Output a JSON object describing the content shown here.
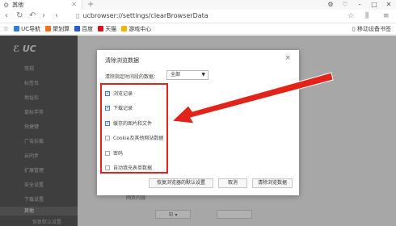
{
  "browser": {
    "tab_title": "其他",
    "tab_icon": "gear-icon",
    "address": "ucbrowser://settings/clearBrowserData",
    "window_controls": [
      "-",
      "□",
      "✕"
    ]
  },
  "bookmarks": {
    "items": [
      {
        "label": "UC导航",
        "color": "#2f7de1"
      },
      {
        "label": "聚划算",
        "color": "#f2711c"
      },
      {
        "label": "百度",
        "color": "#2a5bd7"
      },
      {
        "label": "天猫",
        "color": "#d7141b"
      },
      {
        "label": "游戏中心",
        "color": "#f5b400"
      }
    ],
    "mobile_label": "移动设备书签"
  },
  "settings": {
    "logo": "UC",
    "sidebar": [
      "常规",
      "标签页",
      "地址栏",
      "鼠标手势",
      "快捷键",
      "广告拦截",
      "云同步",
      "扩展管理",
      "安全设置",
      "下载设置",
      "其他"
    ],
    "sidebar_sub": "恢复默认设置",
    "background_label": "网页内容"
  },
  "dialog": {
    "title": "清除浏览数据",
    "close": "×",
    "range_label": "清除指定时间段的数据：",
    "range_value": "全部",
    "options": [
      {
        "label": "浏览记录",
        "checked": true
      },
      {
        "label": "下载记录",
        "checked": true
      },
      {
        "label": "缓存的图片和文件",
        "checked": true
      },
      {
        "label": "Cookie及其他网站数据",
        "checked": false
      },
      {
        "label": "密码",
        "checked": false
      },
      {
        "label": "自动填充表单数据",
        "checked": false
      }
    ],
    "buttons": {
      "restore": "恢复浏览器的默认设置",
      "cancel": "取消",
      "clear": "清除浏览数据"
    }
  },
  "colors": {
    "highlight": "#e2231a",
    "sidebar": "#575757",
    "check": "#3a7bd5"
  }
}
